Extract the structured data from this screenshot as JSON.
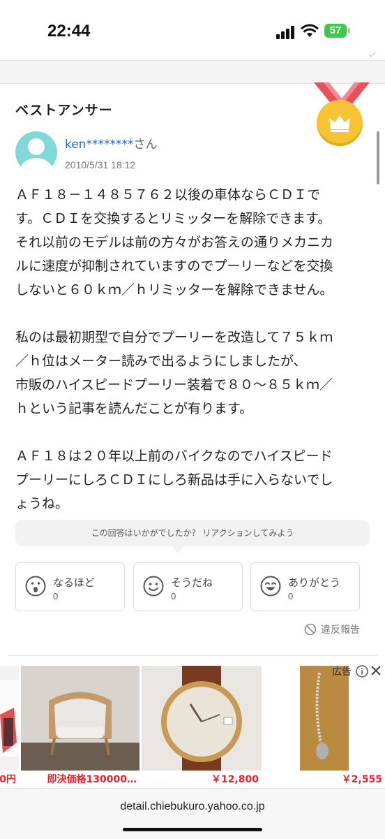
{
  "status_bar": {
    "time": "22:44",
    "battery": "57"
  },
  "best_answer": {
    "title": "ベストアンサー",
    "username": "ken********",
    "username_suffix": "さん",
    "date": "2010/5/31 18:12"
  },
  "answer": {
    "p1_lines": [
      "ＡＦ１８－１４８５７６２以後の車体ならＣＤＩで",
      "す。ＣＤＩを交換するとリミッターを解除できます。",
      "それ以前のモデルは前の方々がお答えの通りメカニカ",
      "ルに速度が抑制されていますのでプーリーなどを交換",
      "しないと６０ｋｍ／ｈリミッターを解除できません。"
    ],
    "p2_lines": [
      "私のは最初期型で自分でプーリーを改造して７５ｋｍ",
      "／ｈ位はメーター読みで出るようにしましたが、",
      "市販のハイスピードプーリー装着で８０～８５ｋｍ／",
      "ｈという記事を読んだことが有ります。"
    ],
    "p3_lines": [
      "ＡＦ１８は２０年以上前のバイクなのでハイスピード",
      "プーリーにしろＣＤＩにしろ新品は手に入らないでし",
      "ょうね。"
    ]
  },
  "reaction": {
    "prompt": "この回答はいかがでしたか？ リアクションしてみよう",
    "buttons": [
      {
        "label": "なるほど",
        "count": "0",
        "icon": "surprised-face-icon"
      },
      {
        "label": "そうだね",
        "count": "0",
        "icon": "smile-face-icon"
      },
      {
        "label": "ありがとう",
        "count": "0",
        "icon": "grin-face-icon"
      }
    ],
    "report": "違反報告"
  },
  "ads": {
    "label": "広告",
    "items": [
      {
        "price": "0円"
      },
      {
        "price": "即決価格130000…"
      },
      {
        "price": "￥12,800"
      },
      {
        "price": "￥2,555"
      }
    ]
  },
  "browser": {
    "url": "detail.chiebukuro.yahoo.co.jp"
  }
}
